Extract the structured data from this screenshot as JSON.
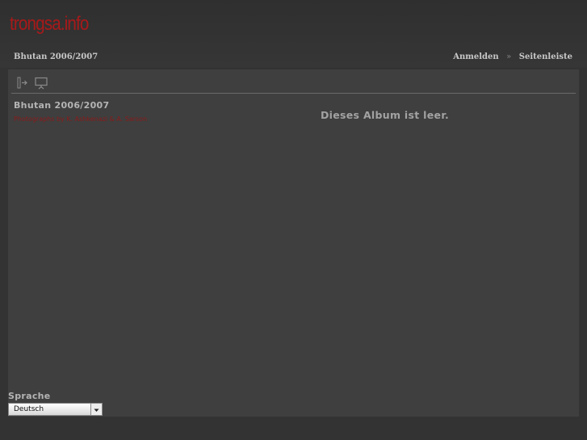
{
  "header": {
    "logo": "trongsa.info",
    "breadcrumb": "Bhutan 2006/2007",
    "links": [
      {
        "label": "Anmelden"
      },
      {
        "label": "Seitenleiste"
      }
    ],
    "separator": "»"
  },
  "toolbar": {
    "icons": [
      "exit-to-parent-icon",
      "slideshow-icon"
    ]
  },
  "album": {
    "title": "Bhutan 2006/2007",
    "description": "Photographs by K. Ashkenazi & A. Sarson",
    "empty_message": "Dieses Album ist leer."
  },
  "language": {
    "label": "Sprache",
    "selected": "Deutsch"
  },
  "colors": {
    "background": "#333333",
    "panel": "#3f3f3f",
    "logo": "#a8191a",
    "description": "#8b1a1a"
  }
}
